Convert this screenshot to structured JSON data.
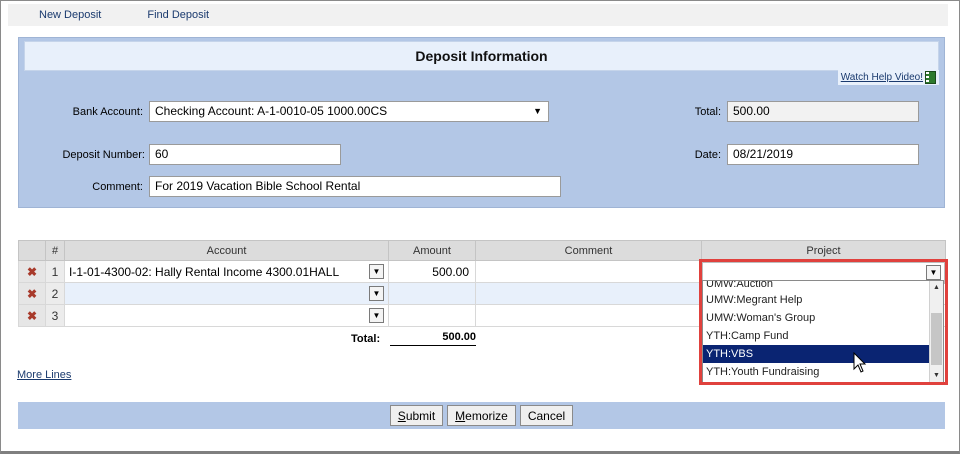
{
  "nav": {
    "new_deposit": "New Deposit",
    "find_deposit": "Find Deposit"
  },
  "panel": {
    "title": "Deposit Information",
    "help_link": "Watch Help Video!",
    "bank_account_label": "Bank Account:",
    "bank_account_value": "Checking Account: A-1-0010-05 1000.00CS",
    "total_label": "Total:",
    "total_value": "500.00",
    "deposit_number_label": "Deposit Number:",
    "deposit_number_value": "60",
    "date_label": "Date:",
    "date_value": "08/21/2019",
    "comment_label": "Comment:",
    "comment_value": "For 2019 Vacation Bible School Rental"
  },
  "grid": {
    "headers": {
      "num": "#",
      "account": "Account",
      "amount": "Amount",
      "comment": "Comment",
      "project": "Project"
    },
    "rows": [
      {
        "num": "1",
        "account": "I-1-01-4300-02: Hally Rental Income 4300.01HALL",
        "amount": "500.00",
        "comment": ""
      },
      {
        "num": "2",
        "account": "",
        "amount": "",
        "comment": ""
      },
      {
        "num": "3",
        "account": "",
        "amount": "",
        "comment": ""
      }
    ],
    "total_label": "Total:",
    "total_value": "500.00",
    "more_lines": "More Lines"
  },
  "project_dropdown": {
    "items": [
      "UMW:Auction",
      "UMW:Megrant Help",
      "UMW:Woman's Group",
      "YTH:Camp Fund",
      "YTH:VBS",
      "YTH:Youth Fundraising"
    ],
    "highlighted": "YTH:VBS"
  },
  "buttons": {
    "submit_first": "S",
    "submit_rest": "ubmit",
    "memorize_first": "M",
    "memorize_rest": "emorize",
    "cancel": "Cancel"
  },
  "colors": {
    "panel_bg": "#b3c7e6",
    "highlight": "#0a2472",
    "annotation_red": "#e0413d",
    "delete_x": "#a83a2b"
  }
}
